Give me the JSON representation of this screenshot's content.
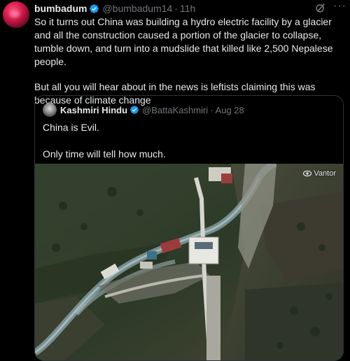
{
  "tweet": {
    "author_name": "bumbadum",
    "author_handle": "@bumbadum14",
    "time": "11h",
    "paragraph1": "So it turns out China was building a hydro electric facility by a glacier and all the construction caused a portion of the glacier to collapse, tumble down, and turn into a mudslide that killed like 2,500 Nepalese people.",
    "paragraph2": "But all you will hear about in the news is leftists claiming this was because of climate change"
  },
  "quote": {
    "author_name": "Kashmiri Hindu",
    "author_handle": "@BattaKashmiri",
    "time": "Aug 28",
    "line1": "China is Evil.",
    "line2": "Only time will tell how much.",
    "media_watermark": "Vantor"
  },
  "colors": {
    "verified": "#1d9bf0",
    "text": "#e7e9ea",
    "muted": "#71767b",
    "border": "#2f3336"
  },
  "icons": [
    "verified-badge-icon",
    "grok-icon",
    "more-icon",
    "vantor-logo-icon"
  ]
}
